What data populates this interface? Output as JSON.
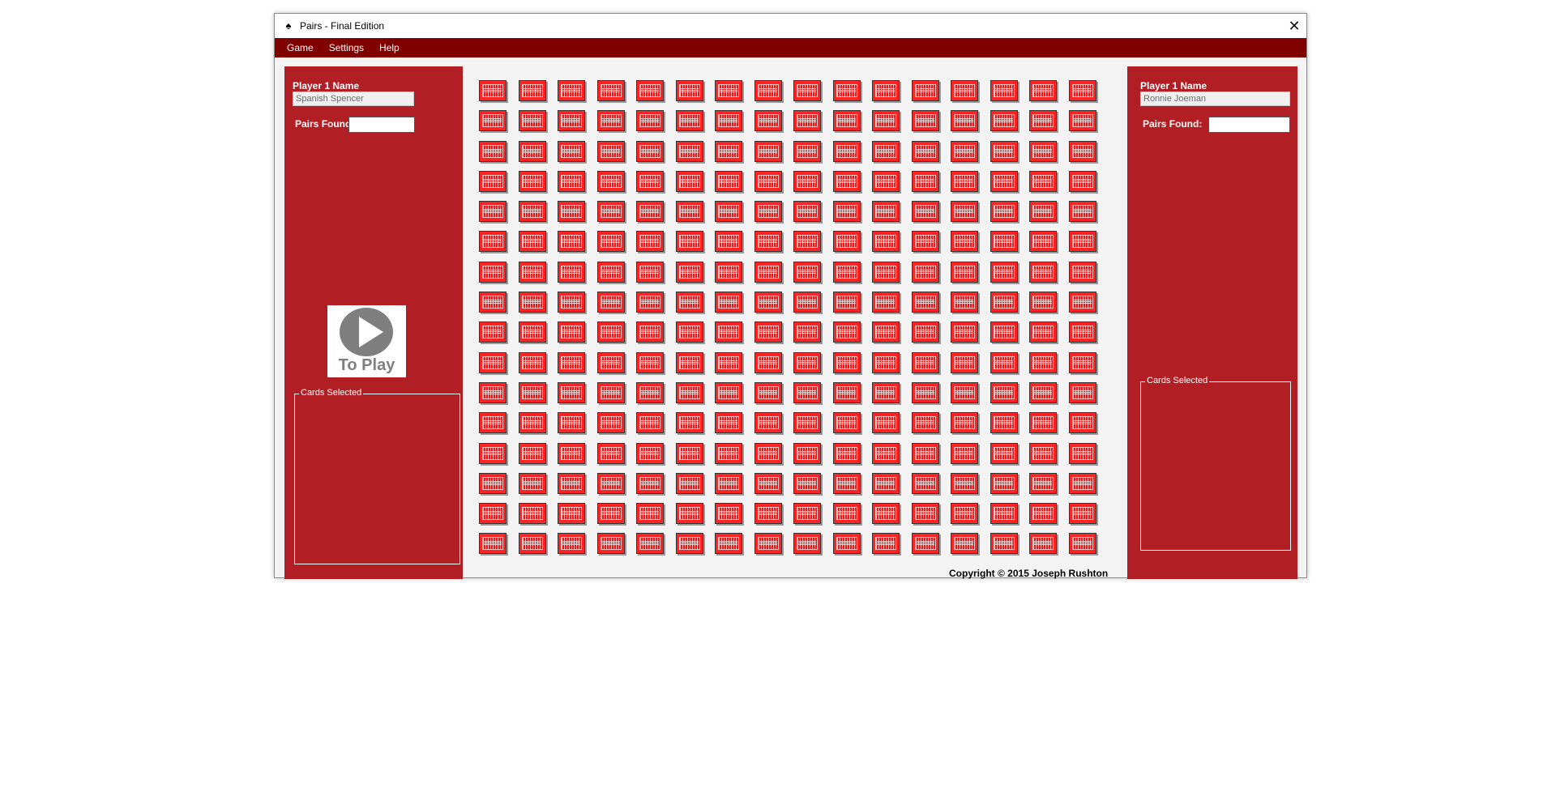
{
  "window": {
    "title": "Pairs - Final Edition",
    "icon": "spade-card-icon",
    "close_glyph": "✕"
  },
  "menu": [
    "Game",
    "Settings",
    "Help"
  ],
  "left_player": {
    "name_label": "Player 1 Name",
    "name_value": "Spanish Spencer",
    "pairs_label": "Pairs Found:",
    "pairs_value": "",
    "cards_selected_label": "Cards Selected"
  },
  "right_player": {
    "name_label": "Player 1 Name",
    "name_value": "Ronnie Joeman",
    "pairs_label": "Pairs Found:",
    "pairs_value": "",
    "cards_selected_label": "Cards Selected"
  },
  "play_button": {
    "label": "To Play",
    "icon": "play-icon"
  },
  "board": {
    "rows": 16,
    "columns": 16,
    "card_back": "red-card-back"
  },
  "copyright": "Copyright © 2015 Joseph Rushton",
  "colors": {
    "menubar": "#800000",
    "panel": "#b11f24",
    "card": "#ff2323",
    "board_bg": "#f3f3f3"
  }
}
